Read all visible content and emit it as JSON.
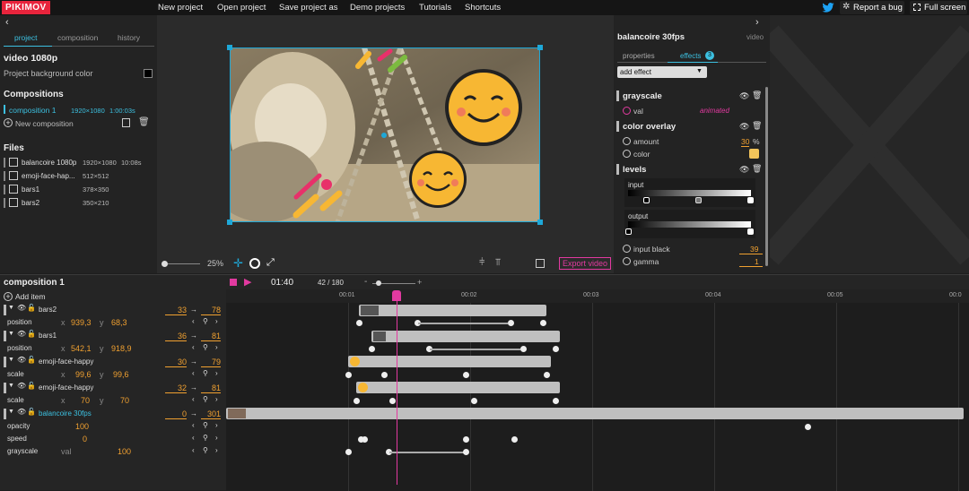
{
  "menubar": {
    "logo": "PIKIMOV",
    "items": [
      "New project",
      "Open project",
      "Save project as",
      "Demo projects",
      "Tutorials",
      "Shortcuts"
    ],
    "report_bug": "Report a bug",
    "full_screen": "Full screen",
    "logo_color": "#e8243c"
  },
  "left": {
    "tabs": [
      "project",
      "composition",
      "history"
    ],
    "active_tab": "project",
    "project_name": "video 1080p",
    "bg_color_label": "Project background color",
    "compositions_heading": "Compositions",
    "composition": {
      "name": "composition 1",
      "size": "1920×1080",
      "duration": "1:00:03s"
    },
    "new_composition": "New composition",
    "files_heading": "Files",
    "files": [
      {
        "name": "balancoire 1080p",
        "size": "1920×1080",
        "duration": "10:08s",
        "icon": "film-icon"
      },
      {
        "name": "emoji-face-hap...",
        "size": "512×512",
        "duration": "",
        "icon": "image-icon"
      },
      {
        "name": "bars1",
        "size": "378×350",
        "duration": "",
        "icon": "image-icon"
      },
      {
        "name": "bars2",
        "size": "350×210",
        "duration": "",
        "icon": "image-icon"
      }
    ]
  },
  "stage": {
    "zoom": "25%",
    "export": "Export video"
  },
  "right": {
    "title": "balancoire 30fps",
    "type": "video",
    "tabs": {
      "properties": "properties",
      "effects": "effects",
      "effects_count": "3"
    },
    "add_effect": "add effect",
    "effects": {
      "grayscale": {
        "name": "grayscale",
        "val_label": "val",
        "val_value": "animated"
      },
      "color_overlay": {
        "name": "color overlay",
        "amount_label": "amount",
        "amount_value": "30",
        "amount_unit": "%",
        "color_label": "color",
        "color": "#f2c45a"
      },
      "levels": {
        "name": "levels",
        "input_label": "input",
        "output_label": "output",
        "input_black_label": "input black",
        "input_black_value": "39",
        "gamma_label": "gamma",
        "gamma_value": "1"
      }
    }
  },
  "timeline": {
    "comp_name": "composition 1",
    "add_item": "Add item",
    "time": "01:40",
    "frame": "42 / 180",
    "ruler": [
      "00:01",
      "00:02",
      "00:03",
      "00:04",
      "00:05",
      "00:0"
    ],
    "layers": [
      {
        "name": "bars2",
        "in": "33",
        "out": "78",
        "prop": "position",
        "x": "939,3",
        "y": "68,3"
      },
      {
        "name": "bars1",
        "in": "36",
        "out": "81",
        "prop": "position",
        "x": "542,1",
        "y": "918,9"
      },
      {
        "name": "emoji-face-happy",
        "in": "30",
        "out": "79",
        "prop": "scale",
        "x": "99,6",
        "y": "99,6"
      },
      {
        "name": "emoji-face-happy",
        "in": "32",
        "out": "81",
        "prop": "scale",
        "x": "70",
        "y": "70"
      },
      {
        "name": "balancoire 30fps",
        "in": "0",
        "out": "301"
      }
    ],
    "extra_props": [
      {
        "name": "opacity",
        "value": "100"
      },
      {
        "name": "speed",
        "value": "0"
      },
      {
        "name": "grayscale",
        "sub": "val",
        "value": "100"
      }
    ]
  }
}
